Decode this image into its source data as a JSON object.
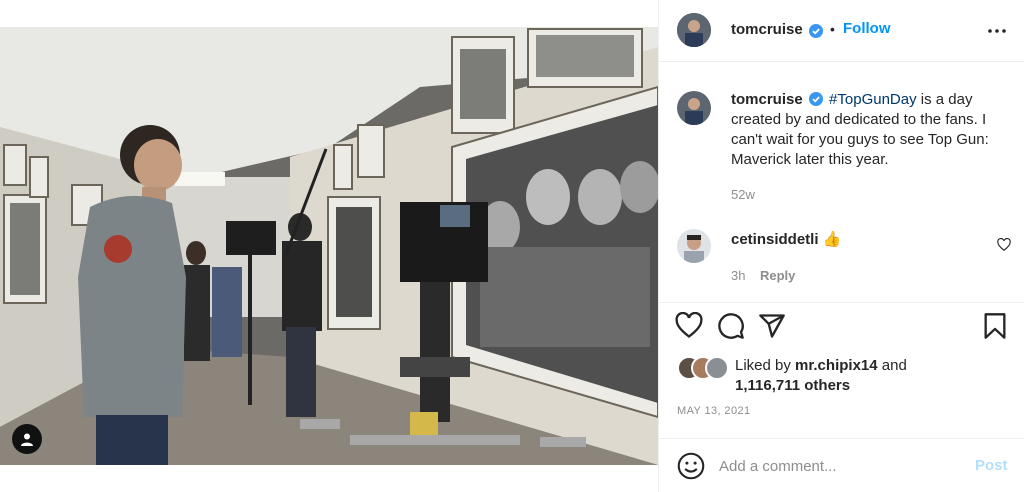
{
  "post": {
    "author": "tomcruise",
    "follow_label": "Follow",
    "separator": "•",
    "caption_hashtag": "#TopGunDay",
    "caption_rest": " is a day created by and dedicated to the fans. I can't wait for you guys to see Top Gun: Maverick later this year.",
    "caption_age": "52w",
    "comment": {
      "user": "cetinsiddetli",
      "text": "👍",
      "age": "3h",
      "reply_label": "Reply"
    },
    "likes": {
      "prefix": "Liked by ",
      "user": "mr.chipix14",
      "joiner": " and",
      "others": "1,116,711 others"
    },
    "date": "MAY 13, 2021",
    "add_comment_placeholder": "Add a comment...",
    "post_label": "Post"
  },
  "icons": {
    "verified": "verified-badge-icon",
    "more": "more-options-icon",
    "heart": "heart-icon",
    "comment": "comment-icon",
    "share": "share-icon",
    "save": "bookmark-icon",
    "emoji": "emoji-icon",
    "tag": "user-tag-icon"
  },
  "colors": {
    "accent": "#0095f6",
    "verified": "#3897f0",
    "hashtag": "#00376b",
    "muted": "#8e8e8e",
    "post_disabled": "#b2dffc"
  }
}
